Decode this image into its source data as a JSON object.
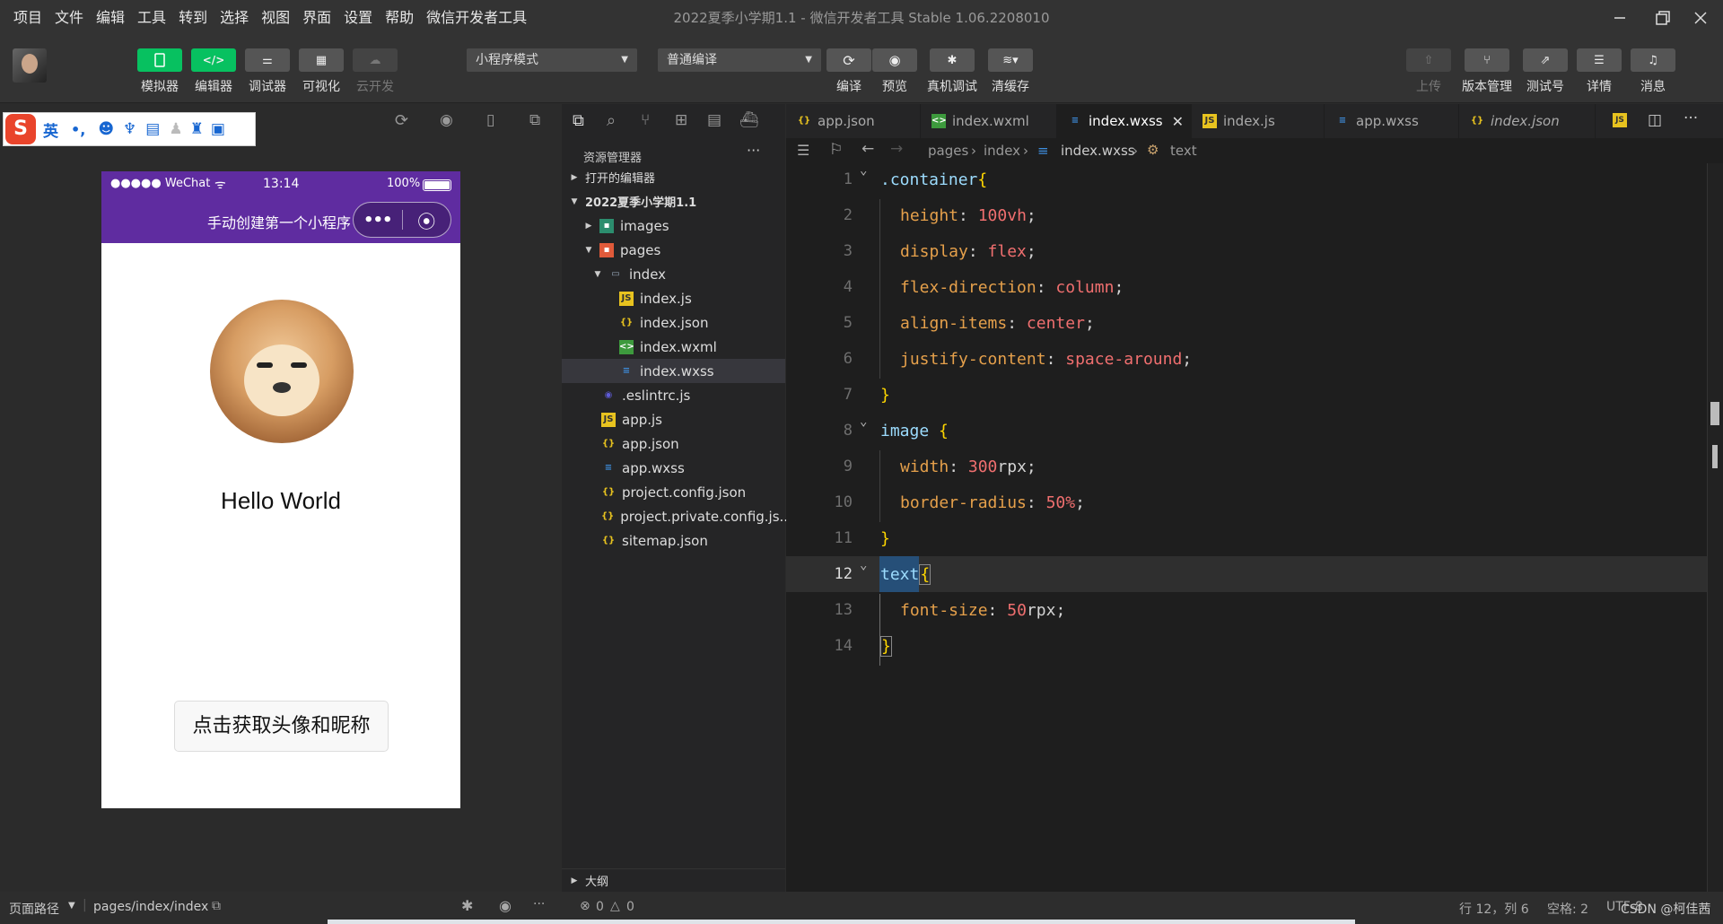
{
  "menubar": {
    "items": [
      "项目",
      "文件",
      "编辑",
      "工具",
      "转到",
      "选择",
      "视图",
      "界面",
      "设置",
      "帮助",
      "微信开发者工具"
    ],
    "title": "2022夏季小学期1.1 - 微信开发者工具 Stable 1.06.2208010"
  },
  "toolbar": {
    "simulator": "模拟器",
    "editor": "编辑器",
    "debugger": "调试器",
    "visual": "可视化",
    "cloud": "云开发",
    "mode_select": "小程序模式",
    "compile_select": "普通编译",
    "compile": "编译",
    "preview": "预览",
    "remote_debug": "真机调试",
    "clear_cache": "清缓存",
    "upload": "上传",
    "version": "版本管理",
    "test_id": "测试号",
    "details": "详情",
    "messages": "消息"
  },
  "ime": {
    "lang": "英"
  },
  "phone": {
    "carrier": "●●●●● WeChat",
    "time": "13:14",
    "battery": "100%",
    "nav_title": "手动创建第一个小程序",
    "hello": "Hello World",
    "button": "点击获取头像和昵称"
  },
  "explorer": {
    "title": "资源管理器",
    "open_editors": "打开的编辑器",
    "project": "2022夏季小学期1.1",
    "items": [
      {
        "name": "images"
      },
      {
        "name": "pages"
      },
      {
        "name": "index"
      },
      {
        "name": "index.js"
      },
      {
        "name": "index.json"
      },
      {
        "name": "index.wxml"
      },
      {
        "name": "index.wxss"
      },
      {
        "name": ".eslintrc.js"
      },
      {
        "name": "app.js"
      },
      {
        "name": "app.json"
      },
      {
        "name": "app.wxss"
      },
      {
        "name": "project.config.json"
      },
      {
        "name": "project.private.config.js..."
      },
      {
        "name": "sitemap.json"
      }
    ],
    "outline": "大纲",
    "problems": "0",
    "warnings": "0"
  },
  "tabs": [
    "app.json",
    "index.wxml",
    "index.wxss",
    "index.js",
    "app.wxss",
    "index.json"
  ],
  "breadcrumb": [
    "pages",
    "index",
    "index.wxss",
    "text"
  ],
  "code": {
    "line_numbers": [
      "1",
      "2",
      "3",
      "4",
      "5",
      "6",
      "7",
      "8",
      "9",
      "10",
      "11",
      "12",
      "13",
      "14"
    ],
    "l1_sel": ".container",
    "l2_prop": "height",
    "l2_val": "100vh",
    "l3_prop": "display",
    "l3_val": "flex",
    "l4_prop": "flex-direction",
    "l4_val": "column",
    "l5_prop": "align-items",
    "l5_val": "center",
    "l6_prop": "justify-content",
    "l6_val": "space-around",
    "l8_sel": "image",
    "l9_prop": "width",
    "l9_num": "300",
    "l9_unit": "rpx",
    "l10_prop": "border-radius",
    "l10_val": "50%",
    "l12_sel": "text",
    "l13_prop": "font-size",
    "l13_num": "50",
    "l13_unit": "rpx"
  },
  "statusbar": {
    "page_path_label": "页面路径",
    "page_path": "pages/index/index",
    "cursor": "行 12，列 6",
    "spaces": "空格: 2",
    "encoding": "UTF-8",
    "watermark": "CSDN @柯佳茜"
  },
  "colors": {
    "accent_green": "#07c160",
    "nav_purple": "#5f2ca0"
  }
}
